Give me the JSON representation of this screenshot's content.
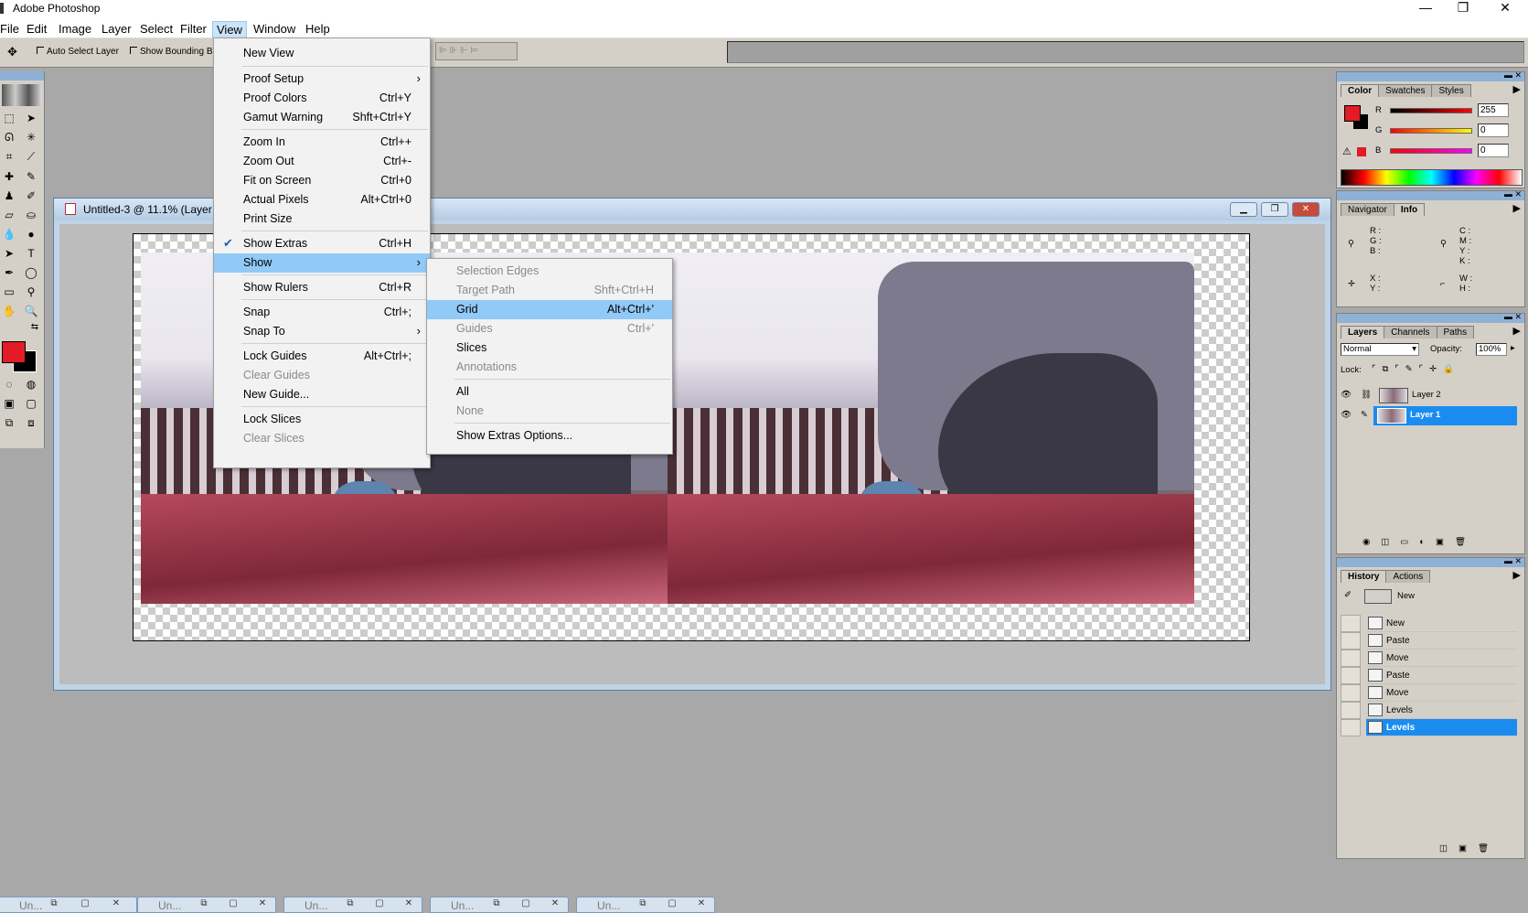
{
  "window": {
    "title": "Adobe Photoshop",
    "minimize": "—",
    "maximize": "❐",
    "close": "✕"
  },
  "menubar": [
    "File",
    "Edit",
    "Image",
    "Layer",
    "Select",
    "Filter",
    "View",
    "Window",
    "Help"
  ],
  "options": {
    "auto_select": "Auto Select Layer",
    "bounding": "Show Bounding B"
  },
  "document": {
    "title": "Untitled-3 @ 11.1% (Layer 1"
  },
  "view_menu": {
    "items": [
      {
        "label": "New View",
        "shortcut": "",
        "sub": false,
        "enabled": true
      },
      {
        "label": "Proof Setup",
        "shortcut": "",
        "sub": true,
        "enabled": true
      },
      {
        "label": "Proof Colors",
        "shortcut": "Ctrl+Y",
        "sub": false,
        "enabled": true
      },
      {
        "label": "Gamut Warning",
        "shortcut": "Shft+Ctrl+Y",
        "sub": false,
        "enabled": true
      },
      {
        "label": "Zoom In",
        "shortcut": "Ctrl++",
        "sub": false,
        "enabled": true
      },
      {
        "label": "Zoom Out",
        "shortcut": "Ctrl+-",
        "sub": false,
        "enabled": true
      },
      {
        "label": "Fit on Screen",
        "shortcut": "Ctrl+0",
        "sub": false,
        "enabled": true
      },
      {
        "label": "Actual Pixels",
        "shortcut": "Alt+Ctrl+0",
        "sub": false,
        "enabled": true
      },
      {
        "label": "Print Size",
        "shortcut": "",
        "sub": false,
        "enabled": true
      },
      {
        "label": "Show Extras",
        "shortcut": "Ctrl+H",
        "sub": false,
        "enabled": true,
        "checked": true
      },
      {
        "label": "Show",
        "shortcut": "",
        "sub": true,
        "enabled": true,
        "highlighted": true
      },
      {
        "label": "Show Rulers",
        "shortcut": "Ctrl+R",
        "sub": false,
        "enabled": true
      },
      {
        "label": "Snap",
        "shortcut": "Ctrl+;",
        "sub": false,
        "enabled": true
      },
      {
        "label": "Snap To",
        "shortcut": "",
        "sub": true,
        "enabled": true
      },
      {
        "label": "Lock Guides",
        "shortcut": "Alt+Ctrl+;",
        "sub": false,
        "enabled": true
      },
      {
        "label": "Clear Guides",
        "shortcut": "",
        "sub": false,
        "enabled": false
      },
      {
        "label": "New Guide...",
        "shortcut": "",
        "sub": false,
        "enabled": true
      },
      {
        "label": "Lock Slices",
        "shortcut": "",
        "sub": false,
        "enabled": true
      },
      {
        "label": "Clear Slices",
        "shortcut": "",
        "sub": false,
        "enabled": false
      }
    ]
  },
  "show_menu": {
    "items": [
      {
        "label": "Selection Edges",
        "shortcut": "",
        "enabled": false
      },
      {
        "label": "Target Path",
        "shortcut": "Shft+Ctrl+H",
        "enabled": false
      },
      {
        "label": "Grid",
        "shortcut": "Alt+Ctrl+'",
        "enabled": true,
        "highlighted": true
      },
      {
        "label": "Guides",
        "shortcut": "Ctrl+'",
        "enabled": false
      },
      {
        "label": "Slices",
        "shortcut": "",
        "enabled": true
      },
      {
        "label": "Annotations",
        "shortcut": "",
        "enabled": false
      },
      {
        "label": "All",
        "shortcut": "",
        "enabled": true
      },
      {
        "label": "None",
        "shortcut": "",
        "enabled": false
      },
      {
        "label": "Show Extras Options...",
        "shortcut": "",
        "enabled": true
      }
    ]
  },
  "color_panel": {
    "tabs": [
      "Color",
      "Swatches",
      "Styles"
    ],
    "r_label": "R",
    "g_label": "G",
    "b_label": "B",
    "r": "255",
    "g": "0",
    "b": "0",
    "foreground": "#e21b24"
  },
  "info_panel": {
    "tabs": [
      "Navigator",
      "Info"
    ],
    "rgb": "R :\nG :\nB :",
    "cmyk": "C :\nM :\nY :\nK :",
    "xy": "X :\nY :",
    "wh": "W :\nH :"
  },
  "layers_panel": {
    "tabs": [
      "Layers",
      "Channels",
      "Paths"
    ],
    "blend": "Normal",
    "opacity_label": "Opacity:",
    "opacity": "100%",
    "lock_label": "Lock:",
    "layers": [
      {
        "name": "Layer 2",
        "selected": false
      },
      {
        "name": "Layer 1",
        "selected": true
      }
    ]
  },
  "history_panel": {
    "tabs": [
      "History",
      "Actions"
    ],
    "snapshot": "New",
    "states": [
      "New",
      "Paste",
      "Move",
      "Paste",
      "Move",
      "Levels",
      "Levels"
    ],
    "selected_index": 6
  },
  "taskbar": {
    "docs": [
      "Un...",
      "Un...",
      "Un...",
      "Un...",
      "Un..."
    ]
  },
  "colors": {
    "accent": "#1a8cf0",
    "menu_highlight": "#91c9f7",
    "foreground_swatch": "#e21b24"
  }
}
